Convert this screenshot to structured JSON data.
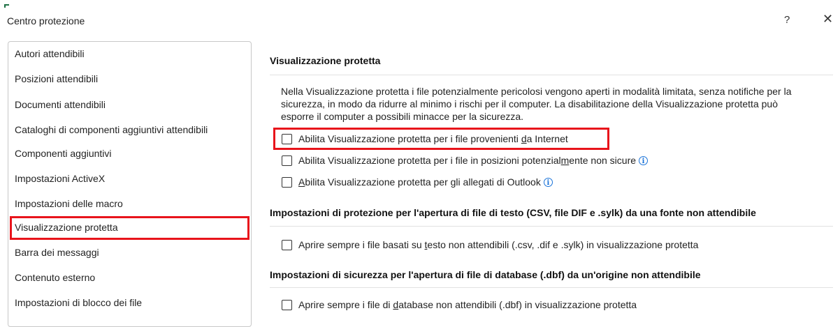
{
  "window": {
    "title": "Centro protezione",
    "help_label": "?",
    "close_label": "✕"
  },
  "sidebar": {
    "items": [
      {
        "label": "Autori attendibili"
      },
      {
        "label": "Posizioni attendibili"
      },
      {
        "label": "Documenti attendibili"
      },
      {
        "label": "Cataloghi di componenti aggiuntivi attendibili"
      },
      {
        "label": "Componenti aggiuntivi"
      },
      {
        "label": "Impostazioni ActiveX"
      },
      {
        "label": "Impostazioni delle macro"
      },
      {
        "label": "Visualizzazione protetta"
      },
      {
        "label": "Barra dei messaggi"
      },
      {
        "label": "Contenuto esterno"
      },
      {
        "label": "Impostazioni di blocco dei file"
      }
    ],
    "selected": "Visualizzazione protetta"
  },
  "main": {
    "protected_view": {
      "heading": "Visualizzazione protetta",
      "description": "Nella Visualizzazione protetta i file potenzialmente pericolosi vengono aperti in modalità limitata, senza notifiche per la sicurezza, in modo da ridurre al minimo i rischi per il computer. La disabilitazione della Visualizzazione protetta può esporre il computer a possibili minacce per la sicurezza.",
      "options": [
        {
          "before": "Abilita Visualizzazione protetta per i file provenienti ",
          "key": "d",
          "after": "a Internet",
          "checked": false,
          "info": false
        },
        {
          "before": "Abilita Visualizzazione protetta per i file in posizioni potenzial",
          "key": "m",
          "after": "ente non sicure",
          "checked": false,
          "info": true
        },
        {
          "before": "",
          "key": "A",
          "after": "bilita Visualizzazione protetta per gli allegati di Outlook",
          "checked": false,
          "info": true
        }
      ]
    },
    "text_files": {
      "heading": "Impostazioni di protezione per l'apertura di file di testo (CSV, file DIF e .sylk) da una fonte non attendibile",
      "option": {
        "before": "Aprire sempre i file basati su ",
        "key": "t",
        "after": "esto non attendibili (.csv, .dif e .sylk) in visualizzazione protetta",
        "checked": false
      }
    },
    "database_files": {
      "heading": "Impostazioni di sicurezza per l'apertura di file di database (.dbf) da un'origine non attendibile",
      "option": {
        "before": "Aprire sempre i file di ",
        "key": "d",
        "after": "atabase non attendibili (.dbf) in visualizzazione protetta",
        "checked": false
      }
    },
    "info_icon_glyph": "i"
  },
  "colors": {
    "highlight_red": "#e8141b",
    "info_blue": "#1a73d9",
    "accent_green": "#1e7145"
  }
}
